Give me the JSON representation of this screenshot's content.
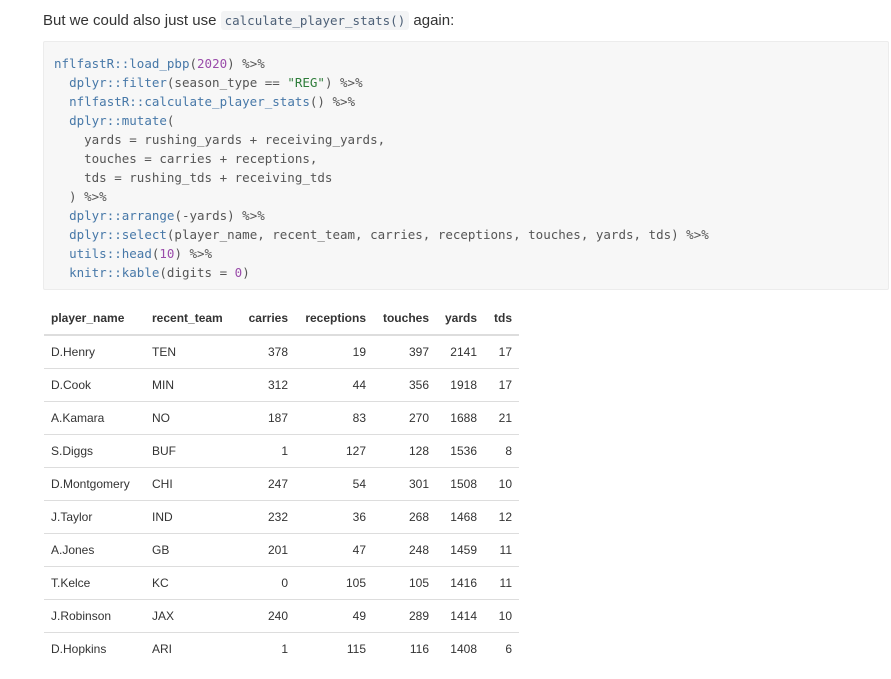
{
  "intro": {
    "before": "But we could also just use ",
    "code": "calculate_player_stats()",
    "after": " again:"
  },
  "code": {
    "lines": [
      [
        [
          "fn",
          "nflfastR::"
        ],
        [
          "fn",
          "load_pbp"
        ],
        [
          "op",
          "("
        ],
        [
          "num",
          "2020"
        ],
        [
          "op",
          ") %>%"
        ]
      ],
      [
        [
          "op",
          "  "
        ],
        [
          "fn",
          "dplyr::"
        ],
        [
          "fn",
          "filter"
        ],
        [
          "op",
          "(season_type == "
        ],
        [
          "str",
          "\"REG\""
        ],
        [
          "op",
          ") %>%"
        ]
      ],
      [
        [
          "op",
          "  "
        ],
        [
          "fn",
          "nflfastR::"
        ],
        [
          "fn",
          "calculate_player_stats"
        ],
        [
          "op",
          "() %>%"
        ]
      ],
      [
        [
          "op",
          "  "
        ],
        [
          "fn",
          "dplyr::"
        ],
        [
          "fn",
          "mutate"
        ],
        [
          "op",
          "("
        ]
      ],
      [
        [
          "op",
          "    yards = rushing_yards + receiving_yards,"
        ]
      ],
      [
        [
          "op",
          "    touches = carries + receptions,"
        ]
      ],
      [
        [
          "op",
          "    tds = rushing_tds + receiving_tds"
        ]
      ],
      [
        [
          "op",
          "  ) %>%"
        ]
      ],
      [
        [
          "op",
          "  "
        ],
        [
          "fn",
          "dplyr::"
        ],
        [
          "fn",
          "arrange"
        ],
        [
          "op",
          "(-yards) %>%"
        ]
      ],
      [
        [
          "op",
          "  "
        ],
        [
          "fn",
          "dplyr::"
        ],
        [
          "fn",
          "select"
        ],
        [
          "op",
          "(player_name, recent_team, carries, receptions, touches, yards, tds) %>%"
        ]
      ],
      [
        [
          "op",
          "  "
        ],
        [
          "fn",
          "utils::"
        ],
        [
          "fn",
          "head"
        ],
        [
          "op",
          "("
        ],
        [
          "num",
          "10"
        ],
        [
          "op",
          ") %>%"
        ]
      ],
      [
        [
          "op",
          "  "
        ],
        [
          "fn",
          "knitr::"
        ],
        [
          "fn",
          "kable"
        ],
        [
          "op",
          "(digits = "
        ],
        [
          "num",
          "0"
        ],
        [
          "op",
          ")"
        ]
      ]
    ]
  },
  "table": {
    "columns": [
      "player_name",
      "recent_team",
      "carries",
      "receptions",
      "touches",
      "yards",
      "tds"
    ],
    "numeric": [
      false,
      false,
      true,
      true,
      true,
      true,
      true
    ],
    "rows": [
      [
        "D.Henry",
        "TEN",
        "378",
        "19",
        "397",
        "2141",
        "17"
      ],
      [
        "D.Cook",
        "MIN",
        "312",
        "44",
        "356",
        "1918",
        "17"
      ],
      [
        "A.Kamara",
        "NO",
        "187",
        "83",
        "270",
        "1688",
        "21"
      ],
      [
        "S.Diggs",
        "BUF",
        "1",
        "127",
        "128",
        "1536",
        "8"
      ],
      [
        "D.Montgomery",
        "CHI",
        "247",
        "54",
        "301",
        "1508",
        "10"
      ],
      [
        "J.Taylor",
        "IND",
        "232",
        "36",
        "268",
        "1468",
        "12"
      ],
      [
        "A.Jones",
        "GB",
        "201",
        "47",
        "248",
        "1459",
        "11"
      ],
      [
        "T.Kelce",
        "KC",
        "0",
        "105",
        "105",
        "1416",
        "11"
      ],
      [
        "J.Robinson",
        "JAX",
        "240",
        "49",
        "289",
        "1414",
        "10"
      ],
      [
        "D.Hopkins",
        "ARI",
        "1",
        "115",
        "116",
        "1408",
        "6"
      ]
    ]
  }
}
